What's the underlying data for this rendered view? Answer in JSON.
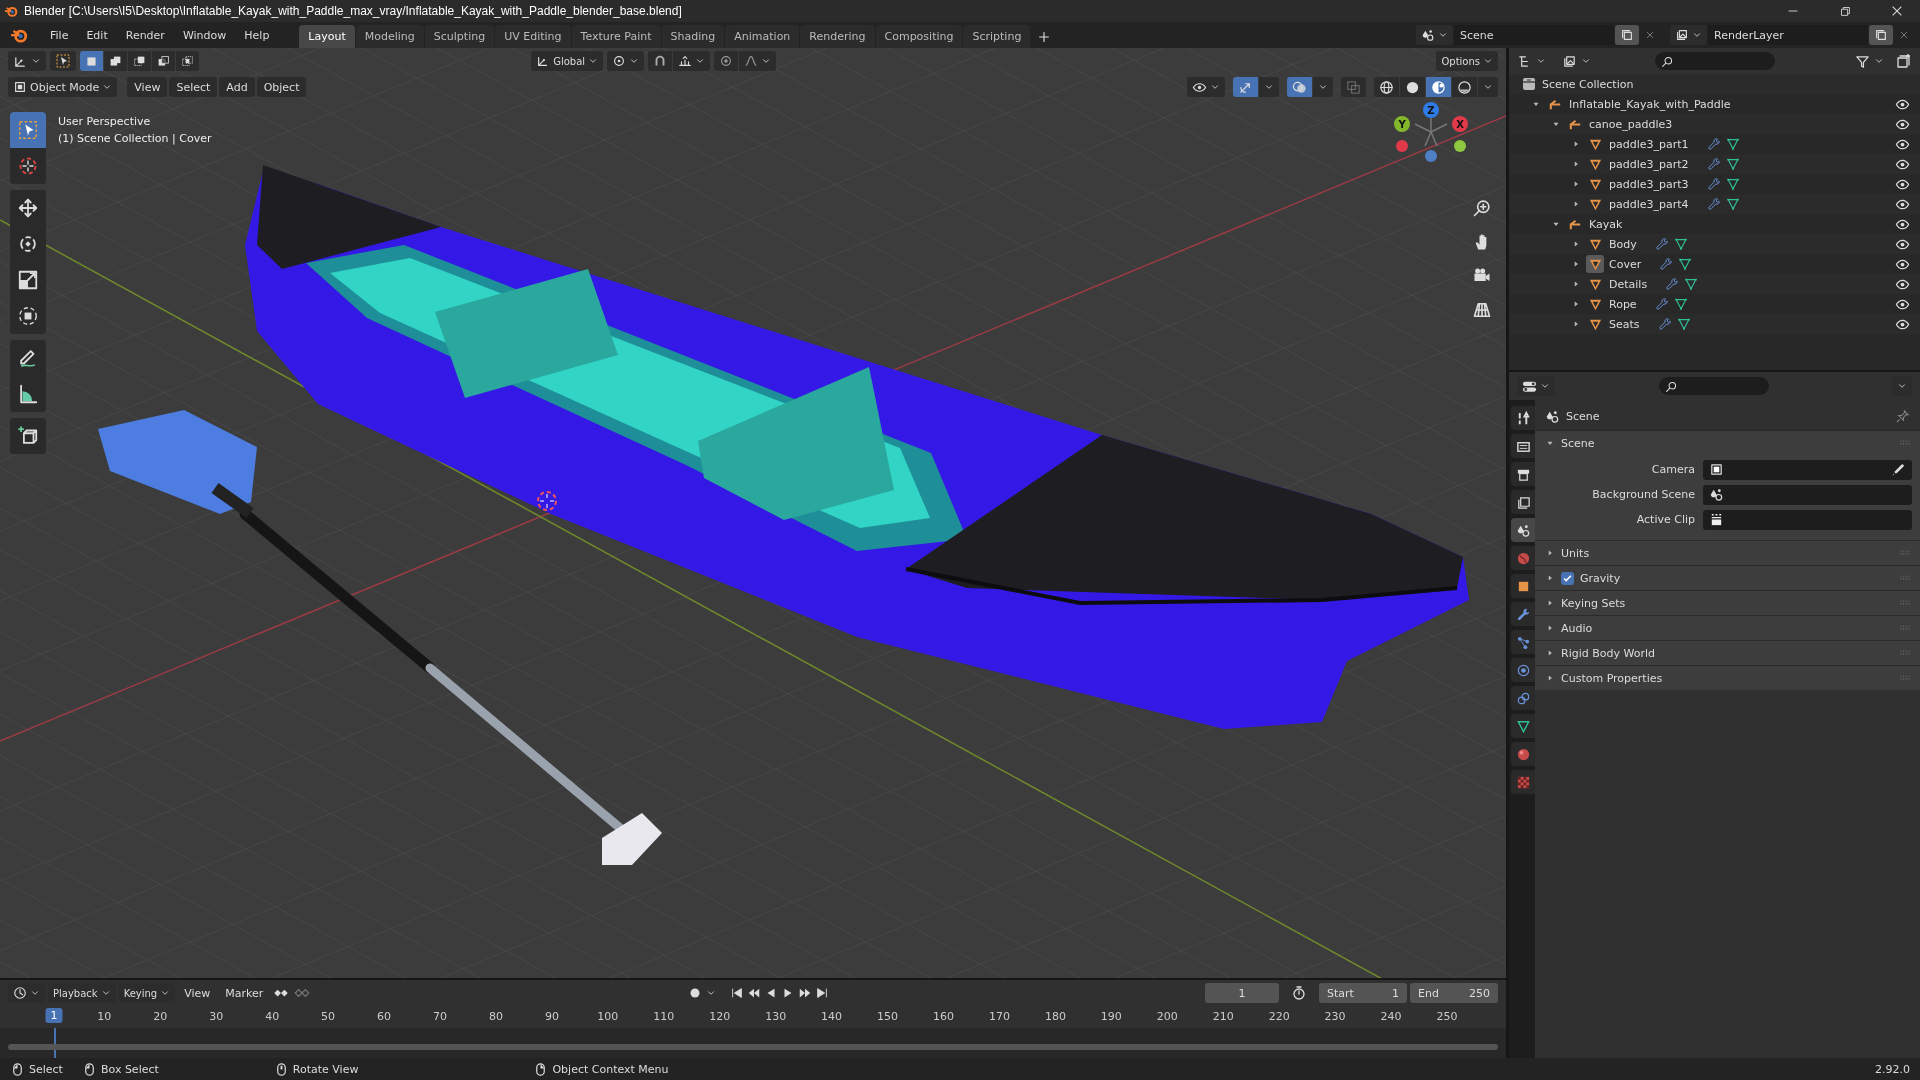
{
  "window": {
    "title": "Blender [C:\\Users\\I5\\Desktop\\Inflatable_Kayak_with_Paddle_max_vray/Inflatable_Kayak_with_Paddle_blender_base.blend]"
  },
  "menu": [
    "File",
    "Edit",
    "Render",
    "Window",
    "Help"
  ],
  "workspaces": [
    {
      "label": "Layout",
      "selected": true
    },
    {
      "label": "Modeling",
      "selected": false
    },
    {
      "label": "Sculpting",
      "selected": false
    },
    {
      "label": "UV Editing",
      "selected": false
    },
    {
      "label": "Texture Paint",
      "selected": false
    },
    {
      "label": "Shading",
      "selected": false
    },
    {
      "label": "Animation",
      "selected": false
    },
    {
      "label": "Rendering",
      "selected": false
    },
    {
      "label": "Compositing",
      "selected": false
    },
    {
      "label": "Scripting",
      "selected": false
    }
  ],
  "scene_selector": {
    "value": "Scene"
  },
  "view_layer_selector": {
    "value": "RenderLayer"
  },
  "tool_header": {
    "select_modes": [
      {
        "kind": "new",
        "selected": true
      },
      {
        "kind": "extend",
        "selected": false
      },
      {
        "kind": "subtract",
        "selected": false
      },
      {
        "kind": "invert",
        "selected": false
      },
      {
        "kind": "intersect",
        "selected": false
      }
    ],
    "orientation": "Global",
    "options": "Options"
  },
  "viewport_header": {
    "mode": "Object Mode",
    "menus": [
      "View",
      "Select",
      "Add",
      "Object"
    ],
    "shading": [
      {
        "kind": "wireframe",
        "selected": false
      },
      {
        "kind": "solid",
        "selected": false
      },
      {
        "kind": "material",
        "selected": true
      },
      {
        "kind": "rendered",
        "selected": false
      }
    ]
  },
  "toolbar": [
    [
      {
        "kind": "select",
        "selected": true
      },
      {
        "kind": "cursor",
        "selected": false
      }
    ],
    [
      {
        "kind": "move",
        "selected": false
      },
      {
        "kind": "rotate",
        "selected": false
      },
      {
        "kind": "scale",
        "selected": false
      },
      {
        "kind": "transform",
        "selected": false
      }
    ],
    [
      {
        "kind": "annotate",
        "selected": false
      },
      {
        "kind": "measure",
        "selected": false
      }
    ],
    [
      {
        "kind": "add_cube",
        "selected": false
      }
    ]
  ],
  "viewport": {
    "overlay_text": [
      "User Perspective",
      "(1) Scene Collection | Cover"
    ],
    "gizmo": [
      {
        "label": "Z",
        "color": "#2f7be6"
      },
      {
        "label": "Y",
        "color": "#82b72c"
      },
      {
        "label": "X",
        "color": "#e0394a"
      }
    ]
  },
  "outliner": {
    "root": "Scene Collection",
    "tree": [
      {
        "name": "Inflatable_Kayak_with_Paddle",
        "kind": "collection",
        "expanded": true,
        "selected": false,
        "children": [
          {
            "name": "canoe_paddle3",
            "kind": "collection",
            "expanded": true,
            "selected": false,
            "children": [
              {
                "name": "paddle3_part1",
                "kind": "mesh",
                "expanded": false,
                "selected": false
              },
              {
                "name": "paddle3_part2",
                "kind": "mesh",
                "expanded": false,
                "selected": false
              },
              {
                "name": "paddle3_part3",
                "kind": "mesh",
                "expanded": false,
                "selected": false
              },
              {
                "name": "paddle3_part4",
                "kind": "mesh",
                "expanded": false,
                "selected": false
              }
            ]
          },
          {
            "name": "Kayak",
            "kind": "collection",
            "expanded": true,
            "selected": false,
            "children": [
              {
                "name": "Body",
                "kind": "mesh",
                "expanded": false,
                "selected": false
              },
              {
                "name": "Cover",
                "kind": "mesh",
                "expanded": false,
                "selected": true
              },
              {
                "name": "Details",
                "kind": "mesh",
                "expanded": false,
                "selected": false
              },
              {
                "name": "Rope",
                "kind": "mesh",
                "expanded": false,
                "selected": false
              },
              {
                "name": "Seats",
                "kind": "mesh",
                "expanded": false,
                "selected": false
              }
            ]
          }
        ]
      }
    ]
  },
  "properties": {
    "tabs": [
      {
        "kind": "tool",
        "selected": false
      },
      {
        "kind": "render",
        "selected": false
      },
      {
        "kind": "output",
        "selected": false
      },
      {
        "kind": "view_layer",
        "selected": false
      },
      {
        "kind": "scene",
        "selected": true
      },
      {
        "kind": "world",
        "selected": false
      },
      {
        "kind": "object",
        "selected": false
      },
      {
        "kind": "modifiers",
        "selected": false
      },
      {
        "kind": "particles",
        "selected": false
      },
      {
        "kind": "physics",
        "selected": false
      },
      {
        "kind": "constraints",
        "selected": false
      },
      {
        "kind": "data",
        "selected": false
      },
      {
        "kind": "material",
        "selected": false
      },
      {
        "kind": "texture",
        "selected": false
      }
    ],
    "context": "Scene",
    "panels": [
      {
        "title": "Scene",
        "kind": "plain",
        "expanded": true,
        "fields": [
          {
            "label": "Camera",
            "kind": "camera"
          },
          {
            "label": "Background Scene",
            "kind": "scene"
          },
          {
            "label": "Active Clip",
            "kind": "clip"
          }
        ]
      },
      {
        "title": "Units",
        "kind": "plain",
        "expanded": false
      },
      {
        "title": "Gravity",
        "kind": "checkbox",
        "expanded": false,
        "checked": true
      },
      {
        "title": "Keying Sets",
        "kind": "plain",
        "expanded": false
      },
      {
        "title": "Audio",
        "kind": "plain",
        "expanded": false
      },
      {
        "title": "Rigid Body World",
        "kind": "plain",
        "expanded": false
      },
      {
        "title": "Custom Properties",
        "kind": "plain",
        "expanded": false
      }
    ]
  },
  "timeline": {
    "menus": [
      "Playback",
      "Keying",
      "View",
      "Marker"
    ],
    "current_frame": "1",
    "start_label": "Start",
    "start": "1",
    "end_label": "End",
    "end": "250",
    "playhead": "1",
    "ruler": [
      "10",
      "20",
      "30",
      "40",
      "50",
      "60",
      "70",
      "80",
      "90",
      "100",
      "110",
      "120",
      "130",
      "140",
      "150",
      "160",
      "170",
      "180",
      "190",
      "200",
      "210",
      "220",
      "230",
      "240",
      "250"
    ]
  },
  "status_bar": {
    "hints": [
      {
        "kind": "left_mouse",
        "label": "Select"
      },
      {
        "kind": "left_mouse",
        "label": "Box Select"
      },
      {
        "kind": "middle_mouse",
        "label": "Rotate View"
      },
      {
        "kind": "right_mouse",
        "label": "Object Context Menu"
      }
    ],
    "version": "2.92.0"
  }
}
